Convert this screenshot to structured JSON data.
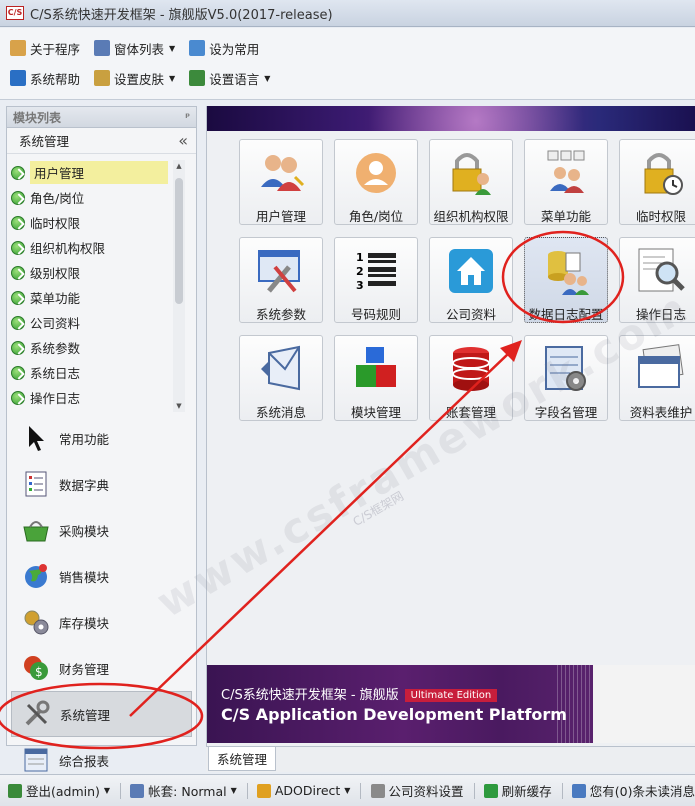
{
  "window": {
    "logo": "C/S",
    "title": "C/S系统快速开发框架 - 旗舰版V5.0(2017-release)"
  },
  "toolbar": {
    "row1": [
      {
        "label": "关于程序",
        "icon": "home-icon",
        "dropdown": false
      },
      {
        "label": "窗体列表",
        "icon": "window-list-icon",
        "dropdown": true
      },
      {
        "label": "设为常用",
        "icon": "favorite-icon",
        "dropdown": false
      }
    ],
    "row2": [
      {
        "label": "系统帮助",
        "icon": "help-icon",
        "dropdown": false
      },
      {
        "label": "设置皮肤",
        "icon": "skin-icon",
        "dropdown": true
      },
      {
        "label": "设置语言",
        "icon": "language-icon",
        "dropdown": true
      }
    ]
  },
  "left_panel": {
    "header": "模块列表",
    "pin": "ᵖ",
    "current": "系统管理",
    "collapse": "«",
    "tree": [
      "用户管理",
      "角色/岗位",
      "临时权限",
      "组织机构权限",
      "级别权限",
      "菜单功能",
      "公司资料",
      "系统参数",
      "系统日志",
      "操作日志"
    ],
    "selected_index": 0,
    "modules": [
      {
        "label": "常用功能",
        "icon": "cursor-icon"
      },
      {
        "label": "数据字典",
        "icon": "dictionary-icon"
      },
      {
        "label": "采购模块",
        "icon": "basket-icon"
      },
      {
        "label": "销售模块",
        "icon": "globe-icon"
      },
      {
        "label": "库存模块",
        "icon": "gears-icon"
      },
      {
        "label": "财务管理",
        "icon": "money-icon"
      },
      {
        "label": "系统管理",
        "icon": "tools-icon"
      },
      {
        "label": "综合报表",
        "icon": "report-icon"
      }
    ],
    "active_module_index": 6
  },
  "tiles": [
    {
      "label": "用户管理",
      "icon": "users-icon"
    },
    {
      "label": "角色/岗位",
      "icon": "person-icon"
    },
    {
      "label": "组织机构权限",
      "icon": "lock-group-icon"
    },
    {
      "label": "菜单功能",
      "icon": "menu-users-icon"
    },
    {
      "label": "临时权限",
      "icon": "lock-clock-icon"
    },
    {
      "label": "系统参数",
      "icon": "settings-tools-icon"
    },
    {
      "label": "号码规则",
      "icon": "numbered-list-icon"
    },
    {
      "label": "公司资料",
      "icon": "company-home-icon"
    },
    {
      "label": "数据日志配置",
      "icon": "data-log-icon"
    },
    {
      "label": "操作日志",
      "icon": "magnifier-log-icon"
    },
    {
      "label": "系统消息",
      "icon": "envelope-icon"
    },
    {
      "label": "模块管理",
      "icon": "blocks-icon"
    },
    {
      "label": "账套管理",
      "icon": "database-icon"
    },
    {
      "label": "字段名管理",
      "icon": "field-gear-icon"
    },
    {
      "label": "资料表维护",
      "icon": "table-window-icon"
    }
  ],
  "highlighted_tile_index": 8,
  "banner": {
    "title": "C/S系统快速开发框架 - 旗舰版",
    "edition": "Ultimate Edition",
    "subtitle": "C/S Application Development Platform"
  },
  "tab": {
    "label": "系统管理"
  },
  "statusbar": [
    {
      "label": "登出(admin)",
      "icon": "logout-icon",
      "dropdown": true
    },
    {
      "label": "帐套: Normal",
      "icon": "account-icon",
      "dropdown": true
    },
    {
      "label": "ADODirect",
      "icon": "lightning-icon",
      "dropdown": true
    },
    {
      "label": "公司资料设置",
      "icon": "settings-icon",
      "dropdown": false
    },
    {
      "label": "刷新缓存",
      "icon": "refresh-icon",
      "dropdown": false
    },
    {
      "label": "您有(0)条未读消息",
      "icon": "speaker-icon",
      "dropdown": false
    }
  ],
  "watermark": {
    "text": "www.csframework.com",
    "sub": "C/S框架网"
  },
  "colors": {
    "highlight": "#f3ef9e",
    "annotation": "#e0221e",
    "banner": "#4a1a60"
  }
}
